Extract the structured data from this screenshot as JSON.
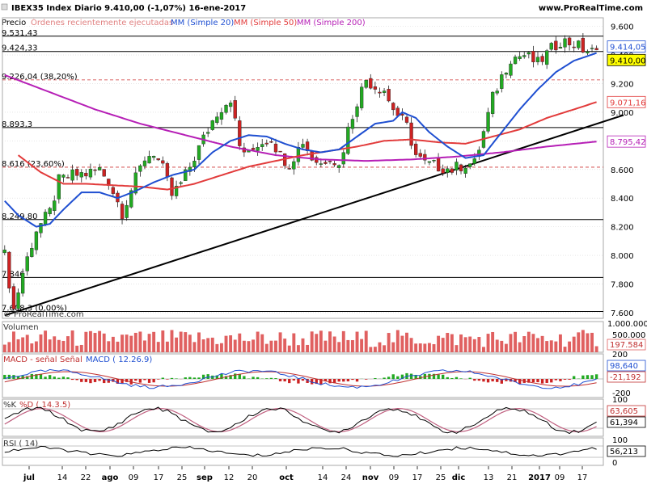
{
  "header": {
    "title": "IBEX35 Index   Diario   9.410,00 (-1,07%)   16-ene-2017",
    "site": "www.ProRealTime.com"
  },
  "legend": {
    "precio": "Precio",
    "orders": "Órdenes recientemente ejecutadas",
    "mm20": "MM (Simple 20)",
    "mm50": "MM (Simple 50)",
    "mm200": "MM (Simple 200)"
  },
  "watermark": "© ProRealTime.com",
  "colors": {
    "up": "#22aa22",
    "down": "#cc2222",
    "mm20": "#1f4fd1",
    "mm50": "#e23b3b",
    "mm200": "#b61fb6",
    "trend": "#000000",
    "volume": "#e06060",
    "grid": "#d6d6d6"
  },
  "chart_data": [
    {
      "type": "candlestick",
      "title": "IBEX35 Index",
      "ylim": [
        7560,
        9660
      ],
      "x_ticks": [
        "jul",
        "14",
        "22",
        "ago",
        "09",
        "17",
        "25",
        "sep",
        "12",
        "20",
        "oct",
        "14",
        "24",
        "nov",
        "09",
        "17",
        "25",
        "dic",
        "13",
        "21",
        "2017",
        "09",
        "17"
      ],
      "y_ticks": [
        "9.600",
        "9.400",
        "9.200",
        "9.000",
        "8.800",
        "8.600",
        "8.400",
        "8.200",
        "8.000",
        "7.800",
        "7.600"
      ],
      "levels": [
        {
          "value": 9531.43,
          "label": "9.531,43",
          "style": "solid"
        },
        {
          "value": 9424.33,
          "label": "9.424,33",
          "style": "solid"
        },
        {
          "value": 9226.0,
          "label": "9.226,04 (38,20%)",
          "style": "dashed"
        },
        {
          "value": 8893.3,
          "label": "8.893,3",
          "style": "solid"
        },
        {
          "value": 8616.0,
          "label": "8.616 (23,60%)",
          "style": "dashed"
        },
        {
          "value": 8249.8,
          "label": "8.249,80",
          "style": "solid"
        },
        {
          "value": 7846.0,
          "label": "7.846",
          "style": "solid"
        },
        {
          "value": 7608.3,
          "label": "7.608,3 (0,00%)",
          "style": "solid"
        }
      ],
      "price_flags": [
        {
          "label": "9.414,05",
          "value": 9414.05,
          "series": "mm20"
        },
        {
          "label": "9.410,00",
          "value": 9410.0,
          "series": "price"
        },
        {
          "label": "9.071,16",
          "value": 9071.16,
          "series": "mm50"
        },
        {
          "label": "8.795,42",
          "value": 8795.42,
          "series": "mm200"
        }
      ],
      "trendline": {
        "from": {
          "i": 0,
          "v": 7580
        },
        "to": {
          "i": 137,
          "v": 8980
        }
      },
      "price_anchors": [
        [
          0,
          8000
        ],
        [
          2,
          7620
        ],
        [
          4,
          7880
        ],
        [
          7,
          8180
        ],
        [
          10,
          8300
        ],
        [
          12,
          8520
        ],
        [
          15,
          8560
        ],
        [
          18,
          8570
        ],
        [
          21,
          8600
        ],
        [
          23,
          8520
        ],
        [
          26,
          8300
        ],
        [
          28,
          8460
        ],
        [
          31,
          8680
        ],
        [
          33,
          8720
        ],
        [
          35,
          8600
        ],
        [
          37,
          8420
        ],
        [
          39,
          8500
        ],
        [
          41,
          8620
        ],
        [
          43,
          8750
        ],
        [
          45,
          8880
        ],
        [
          47,
          9000
        ],
        [
          50,
          9100
        ],
        [
          52,
          8760
        ],
        [
          54,
          8700
        ],
        [
          56,
          8780
        ],
        [
          59,
          8820
        ],
        [
          61,
          8700
        ],
        [
          63,
          8640
        ],
        [
          66,
          8800
        ],
        [
          68,
          8680
        ],
        [
          70,
          8640
        ],
        [
          72,
          8700
        ],
        [
          74,
          8620
        ],
        [
          76,
          8880
        ],
        [
          78,
          9080
        ],
        [
          80,
          9230
        ],
        [
          82,
          9180
        ],
        [
          84,
          9160
        ],
        [
          85,
          9080
        ],
        [
          87,
          8980
        ],
        [
          89,
          8900
        ],
        [
          91,
          8700
        ],
        [
          93,
          8640
        ],
        [
          96,
          8620
        ],
        [
          99,
          8600
        ],
        [
          102,
          8640
        ],
        [
          104,
          8640
        ],
        [
          106,
          8860
        ],
        [
          108,
          9100
        ],
        [
          110,
          9250
        ],
        [
          112,
          9380
        ],
        [
          115,
          9400
        ],
        [
          118,
          9340
        ],
        [
          121,
          9440
        ],
        [
          123,
          9500
        ],
        [
          126,
          9480
        ],
        [
          128,
          9440
        ],
        [
          130,
          9420
        ],
        [
          131,
          9410
        ]
      ],
      "mm20_anchors": [
        [
          0,
          8380
        ],
        [
          3,
          8280
        ],
        [
          7,
          8200
        ],
        [
          10,
          8220
        ],
        [
          13,
          8320
        ],
        [
          17,
          8440
        ],
        [
          21,
          8440
        ],
        [
          25,
          8400
        ],
        [
          29,
          8450
        ],
        [
          33,
          8510
        ],
        [
          37,
          8560
        ],
        [
          42,
          8600
        ],
        [
          46,
          8720
        ],
        [
          50,
          8800
        ],
        [
          54,
          8840
        ],
        [
          58,
          8830
        ],
        [
          62,
          8780
        ],
        [
          66,
          8740
        ],
        [
          70,
          8720
        ],
        [
          74,
          8740
        ],
        [
          78,
          8830
        ],
        [
          82,
          8920
        ],
        [
          86,
          8940
        ],
        [
          88,
          9000
        ],
        [
          91,
          8960
        ],
        [
          94,
          8860
        ],
        [
          98,
          8760
        ],
        [
          102,
          8680
        ],
        [
          106,
          8700
        ],
        [
          110,
          8860
        ],
        [
          114,
          9020
        ],
        [
          118,
          9160
        ],
        [
          122,
          9280
        ],
        [
          126,
          9360
        ],
        [
          131,
          9414
        ]
      ],
      "mm50_anchors": [
        [
          3,
          8700
        ],
        [
          8,
          8580
        ],
        [
          13,
          8500
        ],
        [
          18,
          8500
        ],
        [
          24,
          8490
        ],
        [
          30,
          8480
        ],
        [
          36,
          8460
        ],
        [
          42,
          8500
        ],
        [
          48,
          8560
        ],
        [
          54,
          8620
        ],
        [
          60,
          8660
        ],
        [
          66,
          8700
        ],
        [
          72,
          8730
        ],
        [
          78,
          8760
        ],
        [
          84,
          8800
        ],
        [
          90,
          8810
        ],
        [
          96,
          8790
        ],
        [
          102,
          8780
        ],
        [
          108,
          8830
        ],
        [
          114,
          8880
        ],
        [
          120,
          8960
        ],
        [
          126,
          9020
        ],
        [
          131,
          9071
        ]
      ],
      "mm200_anchors": [
        [
          0,
          9260
        ],
        [
          10,
          9140
        ],
        [
          20,
          9020
        ],
        [
          30,
          8920
        ],
        [
          40,
          8840
        ],
        [
          50,
          8760
        ],
        [
          60,
          8700
        ],
        [
          70,
          8670
        ],
        [
          80,
          8660
        ],
        [
          90,
          8670
        ],
        [
          100,
          8690
        ],
        [
          110,
          8720
        ],
        [
          120,
          8760
        ],
        [
          131,
          8795
        ]
      ]
    },
    {
      "type": "bar",
      "title": "Volumen",
      "y_ticks": [
        "1.000.000",
        "500.000"
      ],
      "last_value_label": "197.584"
    },
    {
      "type": "line",
      "title": "MACD",
      "legend": [
        "MACD - señal",
        "Señal",
        "MACD ( 12.26.9)"
      ],
      "y_ticks": [
        "200",
        "-200"
      ],
      "last_values": [
        "98,640",
        "-21,192"
      ]
    },
    {
      "type": "line",
      "title": "%K",
      "legend": [
        "%D ( 14.3.5)"
      ],
      "y_ticks": [
        "100"
      ],
      "last_values": [
        "63,605",
        "61,394"
      ]
    },
    {
      "type": "line",
      "title": "RSI ( 14)",
      "y_ticks": [
        "100",
        "0"
      ],
      "last_values": [
        "56,213"
      ]
    }
  ]
}
